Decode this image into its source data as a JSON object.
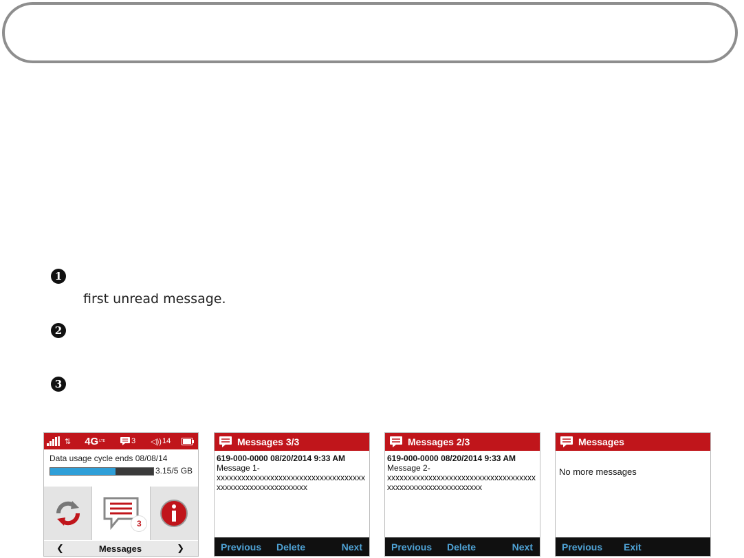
{
  "document": {
    "steps": [
      {
        "num": "1",
        "text": "first unread message."
      },
      {
        "num": "2",
        "text": ""
      },
      {
        "num": "3",
        "text": ""
      }
    ]
  },
  "home_screen": {
    "status": {
      "network": "4G",
      "lte_suffix": "LTE",
      "messages_count": "3",
      "wifi_clients": "14"
    },
    "usage_text": "Data usage cycle ends 08/08/14",
    "usage_amount": "3.15/5 GB",
    "usage_fraction": 0.63,
    "badge_count": "3",
    "nav_prev": "❮",
    "nav_label": "Messages",
    "nav_next": "❯"
  },
  "screens": [
    {
      "title": "Messages 3/3",
      "meta": "619-000-0000 08/20/2014 9:33 AM",
      "label": "Message 1-",
      "body": "xxxxxxxxxxxxxxxxxxxxxxxxxxxxxxxxxxxxxxxxxxxxxxxxxxxxxxxxxx",
      "footer": {
        "left": "Previous",
        "middle": "Delete",
        "right": "Next"
      }
    },
    {
      "title": "Messages 2/3",
      "meta": "619-000-0000 08/20/2014 9:33 AM",
      "label": "Message 2-",
      "body": "xxxxxxxxxxxxxxxxxxxxxxxxxxxxxxxxxxxxxxxxxxxxxxxxxxxxxxxxxxx",
      "footer": {
        "left": "Previous",
        "middle": "Delete",
        "right": "Next"
      }
    },
    {
      "title": "Messages",
      "body": "No more messages",
      "footer": {
        "left": "Previous",
        "middle": "Exit"
      }
    }
  ],
  "colors": {
    "accent_red": "#c0151b",
    "footer_link": "#4fa3d6",
    "usage_fill": "#2f9fd8"
  }
}
